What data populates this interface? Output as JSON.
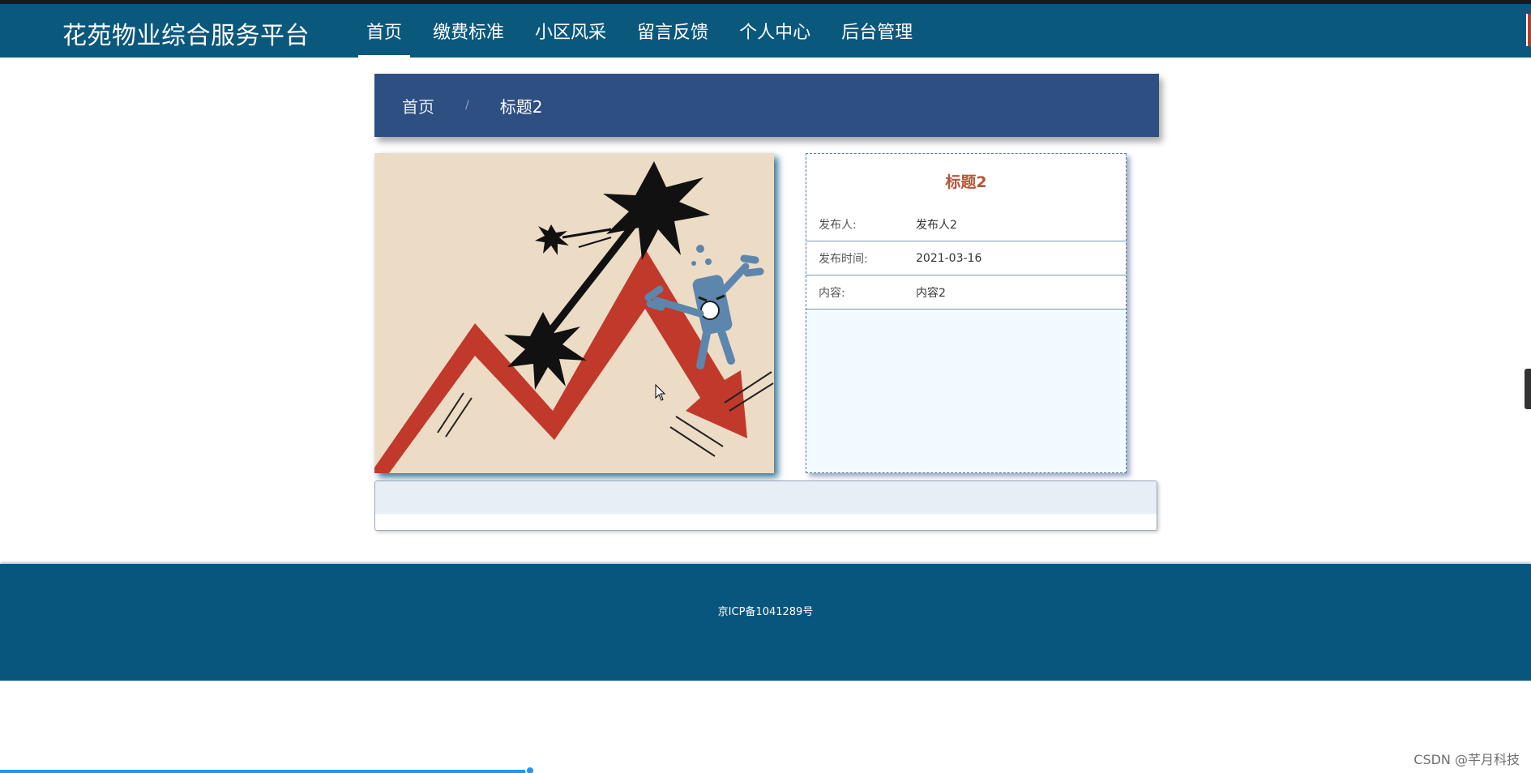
{
  "header": {
    "brand": "花苑物业综合服务平台",
    "nav": [
      "首页",
      "缴费标准",
      "小区风采",
      "留言反馈",
      "个人中心",
      "后台管理"
    ],
    "active_index": 0
  },
  "breadcrumb": {
    "home": "首页",
    "separator": "/",
    "current": "标题2"
  },
  "detail": {
    "title": "标题2",
    "fields": [
      {
        "label": "发布人:",
        "value": "发布人2"
      },
      {
        "label": "发布时间:",
        "value": "2021-03-16"
      },
      {
        "label": "内容:",
        "value": "内容2"
      }
    ]
  },
  "footer": {
    "icp": "京ICP备1041289号"
  },
  "watermark": "CSDN @芊月科技",
  "colors": {
    "nav_bg": "#0b587d",
    "breadcrumb_bg": "#2d4f82",
    "title_accent": "#b8553b",
    "footer_bg": "#08557d"
  }
}
